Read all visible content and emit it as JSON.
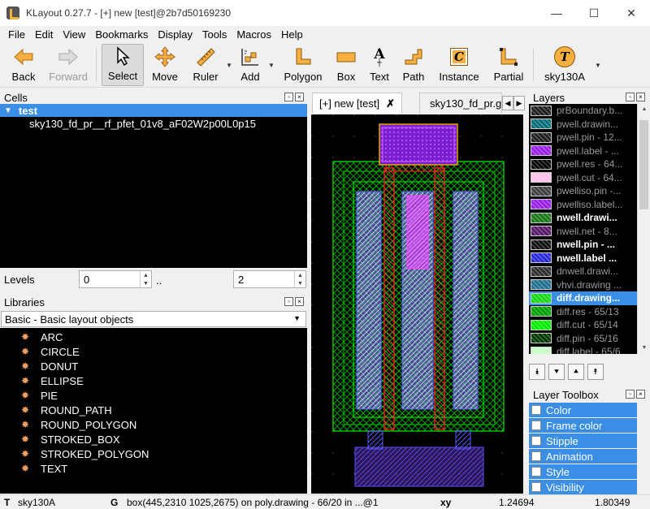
{
  "window": {
    "title": "KLayout 0.27.7 - [+] new [test]@2b7d50169230",
    "min_glyph": "—",
    "max_glyph": "☐",
    "close_glyph": "✕"
  },
  "menu": [
    "File",
    "Edit",
    "View",
    "Bookmarks",
    "Display",
    "Tools",
    "Macros",
    "Help"
  ],
  "toolbar": {
    "back": "Back",
    "forward": "Forward",
    "select": "Select",
    "move": "Move",
    "ruler": "Ruler",
    "add": "Add",
    "polygon": "Polygon",
    "box": "Box",
    "text": "Text",
    "path": "Path",
    "instance": "Instance",
    "partial": "Partial",
    "tech": "sky130A",
    "tech_icon_letter": "T",
    "instance_icon_letter": "C",
    "text_icon_letter": "A"
  },
  "cells": {
    "title": "Cells",
    "root": "test",
    "child": "sky130_fd_pr__rf_pfet_01v8_aF02W2p00L0p15"
  },
  "levels": {
    "label": "Levels",
    "from": "0",
    "sep": "..",
    "to": "2"
  },
  "libraries": {
    "title": "Libraries",
    "selected": "Basic - Basic layout objects",
    "items": [
      "ARC",
      "CIRCLE",
      "DONUT",
      "ELLIPSE",
      "PIE",
      "ROUND_PATH",
      "ROUND_POLYGON",
      "STROKED_BOX",
      "STROKED_POLYGON",
      "TEXT"
    ]
  },
  "tabs": [
    {
      "label": "[+] new [test]",
      "close": "✗"
    },
    {
      "label": "sky130_fd_pr.g"
    }
  ],
  "layers": {
    "title": "Layers",
    "items": [
      {
        "name": "prBoundary.b...",
        "color": "#202020",
        "visible": false
      },
      {
        "name": "pwell.drawin...",
        "color": "#0a6e78",
        "visible": false
      },
      {
        "name": "pwell.pin - 12...",
        "color": "#202020",
        "visible": false
      },
      {
        "name": "pwell.label - ...",
        "color": "#9b1fe8",
        "visible": false
      },
      {
        "name": "pwell.res - 64...",
        "color": "#000000",
        "visible": false
      },
      {
        "name": "pwell.cut - 64...",
        "color": "#ffc0e8",
        "visible": false
      },
      {
        "name": "pwelliso.pin -...",
        "color": "#404040",
        "visible": false
      },
      {
        "name": "pwelliso.label...",
        "color": "#9b1fe8",
        "visible": false
      },
      {
        "name": "nwell.drawi...",
        "color": "#1a7a1a",
        "visible": true
      },
      {
        "name": "nwell.net - 8...",
        "color": "#5a1a6a",
        "visible": false
      },
      {
        "name": "nwell.pin - ...",
        "color": "#101010",
        "visible": true
      },
      {
        "name": "nwell.label ...",
        "color": "#2a2ad8",
        "visible": true
      },
      {
        "name": "dnwell.drawi...",
        "color": "#303030",
        "visible": false
      },
      {
        "name": "vhvi.drawing ...",
        "color": "#207090",
        "visible": false
      },
      {
        "name": "diff.drawing...",
        "color": "#18d818",
        "visible": true,
        "selected": true
      },
      {
        "name": "diff.res - 65/13",
        "color": "#00a000",
        "visible": false
      },
      {
        "name": "diff.cut - 65/14",
        "color": "#00f000",
        "visible": false
      },
      {
        "name": "diff.pin - 65/16",
        "color": "#003a00",
        "visible": false
      },
      {
        "name": "diff.label - 65/6",
        "color": "#c8ffc8",
        "visible": false
      }
    ]
  },
  "layer_nav": [
    "⯯",
    "⯆",
    "⯅",
    "⯭"
  ],
  "layer_toolbox": {
    "title": "Layer Toolbox",
    "rows": [
      "Color",
      "Frame color",
      "Stipple",
      "Animation",
      "Style",
      "Visibility"
    ]
  },
  "status": {
    "t_label": "T",
    "tech": "sky130A",
    "g_label": "G",
    "message": "box(445,2310 1025,2675) on poly.drawing - 66/20 in ...@1",
    "xy_label": "xy",
    "x": "1.24694",
    "y": "1.80349"
  },
  "colors": {
    "accent": "#3a8ee6",
    "nwell": "#00c000",
    "diff": "#18d818",
    "poly": "#e02020",
    "licon": "#6a5aff",
    "met": "#8a2aff",
    "tap": "#e0a000"
  }
}
